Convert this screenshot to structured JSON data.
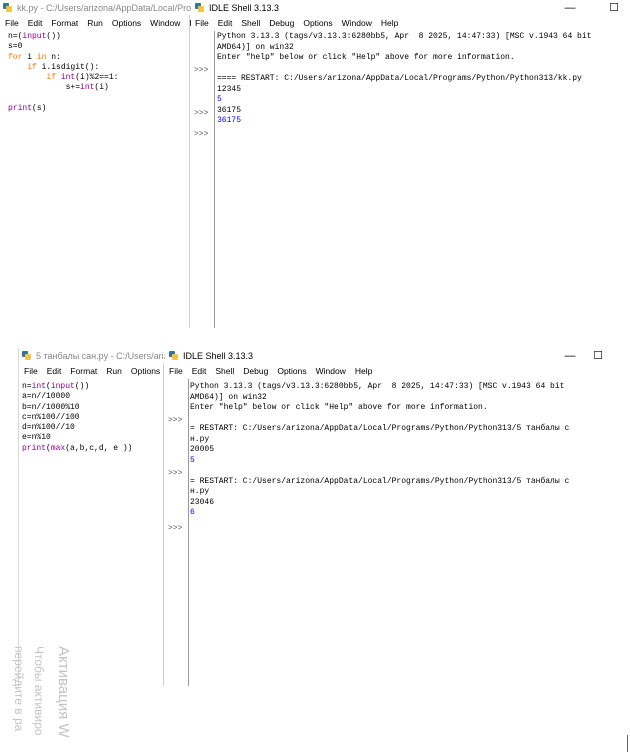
{
  "top": {
    "editor_title": "kk.py - C:/Users/arizona/AppData/Local/Programs",
    "editor_menu": [
      "File",
      "Edit",
      "Format",
      "Run",
      "Options",
      "Window",
      "Help"
    ],
    "code": [
      [
        [
          "n=(",
          "n"
        ],
        [
          "input",
          "bi"
        ],
        [
          "())",
          "n"
        ]
      ],
      [
        [
          "s=0",
          "n"
        ]
      ],
      [
        [
          "for",
          "kw"
        ],
        [
          " i ",
          "n"
        ],
        [
          "in",
          "kw"
        ],
        [
          " n:",
          "n"
        ]
      ],
      [
        [
          "    ",
          "n"
        ],
        [
          "if",
          "kw"
        ],
        [
          " i.isdigit():",
          "n"
        ]
      ],
      [
        [
          "        ",
          "n"
        ],
        [
          "if",
          "kw"
        ],
        [
          " ",
          "n"
        ],
        [
          "int",
          "bi"
        ],
        [
          "(i)%2==1:",
          "n"
        ]
      ],
      [
        [
          "            s+=",
          "n"
        ],
        [
          "int",
          "bi"
        ],
        [
          "(i)",
          "n"
        ]
      ],
      [
        [
          "",
          "n"
        ]
      ],
      [
        [
          "print",
          "bi"
        ],
        [
          "(s)",
          "n"
        ]
      ]
    ],
    "shell_title": "IDLE Shell 3.13.3",
    "shell_menu": [
      "File",
      "Edit",
      "Shell",
      "Debug",
      "Options",
      "Window",
      "Help"
    ],
    "shell_lines": [
      [
        "Python 3.13.3 (tags/v3.13.3:6280bb5, Apr  8 2025, 14:47:33) [MSC v.1943 64 bit",
        "n"
      ],
      [
        "AMD64)] on win32",
        "n"
      ],
      [
        "Enter \"help\" below or click \"Help\" above for more information.",
        "n"
      ],
      [
        "",
        "n"
      ],
      [
        "==== RESTART: C:/Users/arizona/AppData/Local/Programs/Python/Python313/kk.py",
        "n"
      ],
      [
        "12345",
        "n"
      ],
      [
        "5",
        "out"
      ],
      [
        "36175",
        "n"
      ],
      [
        "36175",
        "out"
      ]
    ],
    "prompts": [
      ">>>",
      ">>>",
      ">>>"
    ]
  },
  "bottom": {
    "editor_title": "5 танбалы сан.py - C:/Users/arizona",
    "editor_menu": [
      "File",
      "Edit",
      "Format",
      "Run",
      "Options"
    ],
    "code": [
      [
        [
          "n=",
          "n"
        ],
        [
          "int",
          "bi"
        ],
        [
          "(",
          "n"
        ],
        [
          "input",
          "bi"
        ],
        [
          "())",
          "n"
        ]
      ],
      [
        [
          "a=n//10000",
          "n"
        ]
      ],
      [
        [
          "b=n//1000%10",
          "n"
        ]
      ],
      [
        [
          "c=n%100//100",
          "n"
        ]
      ],
      [
        [
          "d=n%100//10",
          "n"
        ]
      ],
      [
        [
          "e=n%10",
          "n"
        ]
      ],
      [
        [
          "print",
          "bi"
        ],
        [
          "(",
          "n"
        ],
        [
          "max",
          "bi"
        ],
        [
          "(a,b,c,d, e ))",
          "n"
        ]
      ]
    ],
    "shell_title": "IDLE Shell 3.13.3",
    "shell_menu": [
      "File",
      "Edit",
      "Shell",
      "Debug",
      "Options",
      "Window",
      "Help"
    ],
    "shell_lines": [
      [
        "Python 3.13.3 (tags/v3.13.3:6280bb5, Apr  8 2025, 14:47:33) [MSC v.1943 64 bit",
        "n"
      ],
      [
        "AMD64)] on win32",
        "n"
      ],
      [
        "Enter \"help\" below or click \"Help\" above for more information.",
        "n"
      ],
      [
        "",
        "n"
      ],
      [
        "= RESTART: C:/Users/arizona/AppData/Local/Programs/Python/Python313/5 танбалы с",
        "n"
      ],
      [
        "н.py",
        "n"
      ],
      [
        "20005",
        "n"
      ],
      [
        "5",
        "out"
      ],
      [
        "",
        "n"
      ],
      [
        "= RESTART: C:/Users/arizona/AppData/Local/Programs/Python/Python313/5 танбалы с",
        "n"
      ],
      [
        "н.py",
        "n"
      ],
      [
        "23046",
        "n"
      ],
      [
        "6",
        "out"
      ]
    ],
    "prompts": [
      ">>>",
      ">>>",
      ">>>"
    ]
  },
  "watermark": {
    "line1": "Активация W",
    "line2": "Чтобы активиро",
    "line3": "перейдите в ра"
  },
  "controls": {
    "minimize": "—",
    "maximize": "☐"
  }
}
